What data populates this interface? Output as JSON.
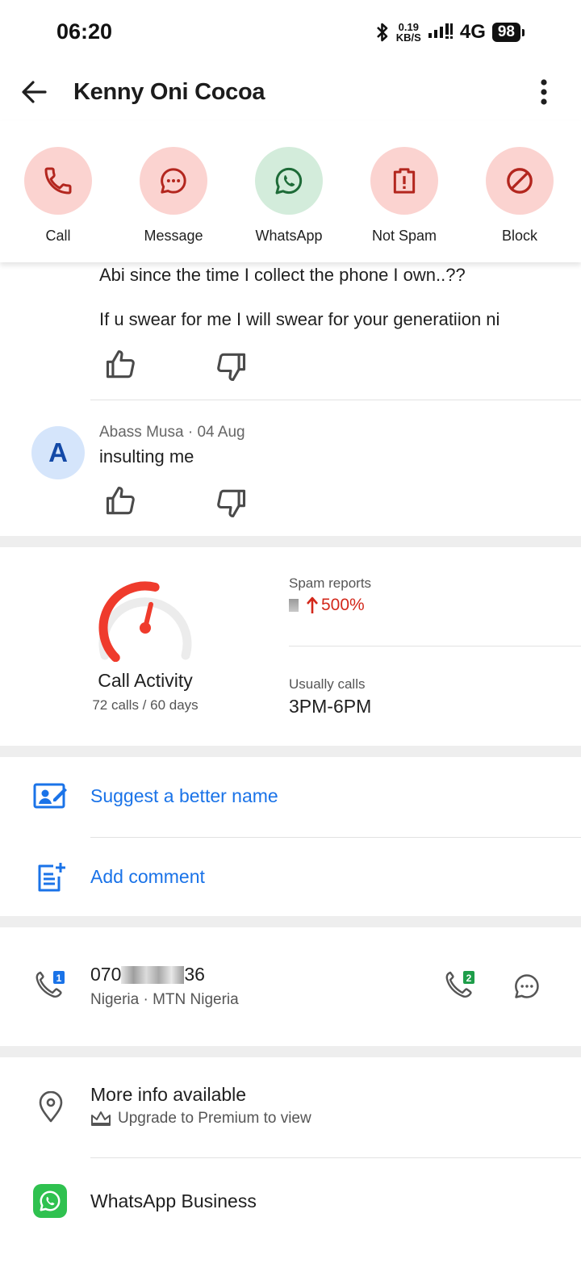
{
  "status": {
    "time": "06:20",
    "speed_value": "0.19",
    "speed_unit": "KB/S",
    "network": "4G",
    "battery": "98"
  },
  "header": {
    "title": "Kenny Oni Cocoa"
  },
  "actions": [
    {
      "label": "Call",
      "icon": "phone-icon",
      "bg": "#fbd3d0",
      "color": "#b3261e"
    },
    {
      "label": "Message",
      "icon": "message-icon",
      "bg": "#fbd3d0",
      "color": "#b3261e"
    },
    {
      "label": "WhatsApp",
      "icon": "whatsapp-icon",
      "bg": "#d3ecdb",
      "color": "#1e6b38"
    },
    {
      "label": "Not Spam",
      "icon": "not-spam-icon",
      "bg": "#fbd3d0",
      "color": "#b3261e"
    },
    {
      "label": "Block",
      "icon": "block-icon",
      "bg": "#fbd3d0",
      "color": "#b3261e"
    }
  ],
  "comments": [
    {
      "lines": [
        "Abi since the time I collect the phone I own..??",
        "If u swear for me I will swear for your generatiion ni"
      ]
    },
    {
      "avatar": "A",
      "author": "Abass Musa",
      "date": "04 Aug",
      "text": "insulting me"
    }
  ],
  "activity": {
    "title": "Call Activity",
    "subtitle": "72 calls / 60 days",
    "gauge_level": 0.55,
    "spam_label": "Spam reports",
    "spam_value": "500%",
    "usually_label": "Usually calls",
    "usually_value": "3PM-6PM"
  },
  "links": {
    "suggest": "Suggest a better name",
    "comment": "Add comment"
  },
  "phone": {
    "prefix": "070",
    "suffix": "36",
    "carrier": "Nigeria · MTN Nigeria",
    "sim1": "1",
    "sim2": "2"
  },
  "info": {
    "more": "More info available",
    "upgrade": "Upgrade to Premium to view",
    "whatsapp_business": "WhatsApp Business"
  },
  "colors": {
    "accent_blue": "#1a73e8",
    "spam_red": "#d3281b",
    "whatsapp_green": "#2fc14f"
  }
}
